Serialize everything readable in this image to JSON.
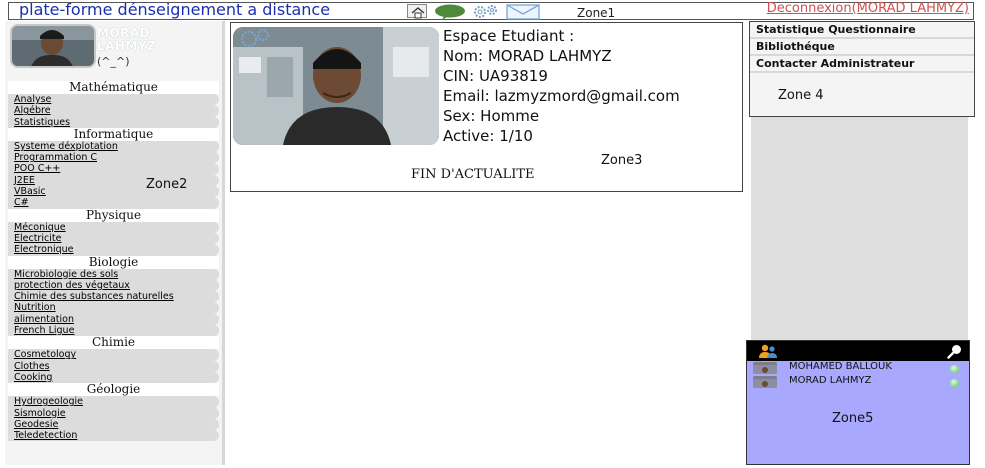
{
  "header": {
    "site_title": "plate-forme dénseignement a distance",
    "zone_label": "Zone1",
    "logout": "Deconnexion(MORAD LAHMYZ)",
    "icons": [
      "home-icon",
      "chat-bubble-icon",
      "gears-icon",
      "mail-icon"
    ]
  },
  "profile": {
    "name_line1": "MORAD",
    "name_line2": "LAHMYZ",
    "emote": "(^_^)"
  },
  "sidebar": {
    "zone_label": "Zone2",
    "categories": [
      {
        "title": "Mathématique",
        "items": [
          "Analyse",
          "Algébre",
          "Statistiques"
        ]
      },
      {
        "title": "Informatique",
        "items": [
          "Systeme déxplotation",
          "Programmation C",
          "POO C++",
          "J2EE",
          "VBasic",
          "C#"
        ]
      },
      {
        "title": "Physique",
        "items": [
          "Méconique",
          "Electricite",
          "Electronique"
        ]
      },
      {
        "title": "Biologie",
        "items": [
          "Microbiologie des sols",
          "protection des végetaux",
          "Chimie des substances naturelles",
          "Nutrition",
          "alimentation",
          "French Ligue"
        ]
      },
      {
        "title": "Chimie",
        "items": [
          "Cosmetology",
          "Clothes",
          "Cooking"
        ]
      },
      {
        "title": "Géologie",
        "items": [
          "Hydrogeologie",
          "Sismologie",
          "Geodesie",
          "Teledetection"
        ]
      }
    ]
  },
  "main": {
    "heading": "Espace Etudiant :",
    "name": "Nom: MORAD LAHMYZ",
    "cin": "CIN: UA93819",
    "email": "Email: lazmyzmord@gmail.com",
    "sex": "Sex: Homme",
    "active": "Active: 1/10",
    "zone_label": "Zone3",
    "end_label": "FIN D'ACTUALITE"
  },
  "right_menu": {
    "items": [
      "Statistique Questionnaire",
      "Bibliothéque",
      "Contacter Administrateur"
    ],
    "zone_label": "Zone 4"
  },
  "chat": {
    "contacts": [
      {
        "name": "MOHAMED BALLOUK",
        "status": "online"
      },
      {
        "name": "MORAD LAHMYZ",
        "status": "online"
      }
    ],
    "zone_label": "Zone5"
  }
}
